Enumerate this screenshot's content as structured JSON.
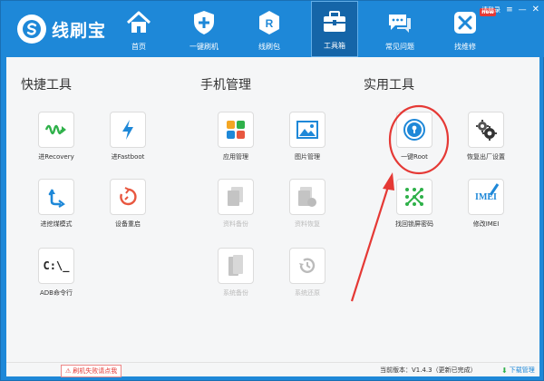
{
  "app": {
    "title": "线刷宝"
  },
  "nav": [
    {
      "label": "首页",
      "icon": "home-icon"
    },
    {
      "label": "一键刷机",
      "icon": "shield-plus-icon"
    },
    {
      "label": "线刷包",
      "icon": "package-r-icon"
    },
    {
      "label": "工具箱",
      "icon": "toolbox-icon",
      "active": true
    },
    {
      "label": "常见问题",
      "icon": "chat-bubble-icon"
    },
    {
      "label": "找维修",
      "icon": "repair-icon",
      "badge": "new"
    }
  ],
  "window": {
    "login": "请登录"
  },
  "sections": {
    "quick": "快捷工具",
    "phone": "手机管理",
    "util": "实用工具"
  },
  "tools": {
    "recovery": "进Recovery",
    "fastboot": "进Fastboot",
    "edl": "进挖煤模式",
    "reboot": "设备重启",
    "adb": "ADB命令行",
    "apps": "应用管理",
    "photos": "图片管理",
    "backup_data": "资料备份",
    "restore_data": "资料恢复",
    "sys_backup": "系统备份",
    "sys_restore": "系统还原",
    "root": "一键Root",
    "factory_reset": "恢复出厂设置",
    "unlock": "找回锁屏密码",
    "imei": "修改IMEI",
    "adb_glyph": "C:\\_",
    "imei_glyph": "IMEI"
  },
  "status": {
    "warning": "刷机失败请点我",
    "version": "当前版本：V1.4.3（更新已完成）",
    "download": "下载管理"
  },
  "colors": {
    "brand": "#1e88d8",
    "annotation": "#e53935"
  }
}
